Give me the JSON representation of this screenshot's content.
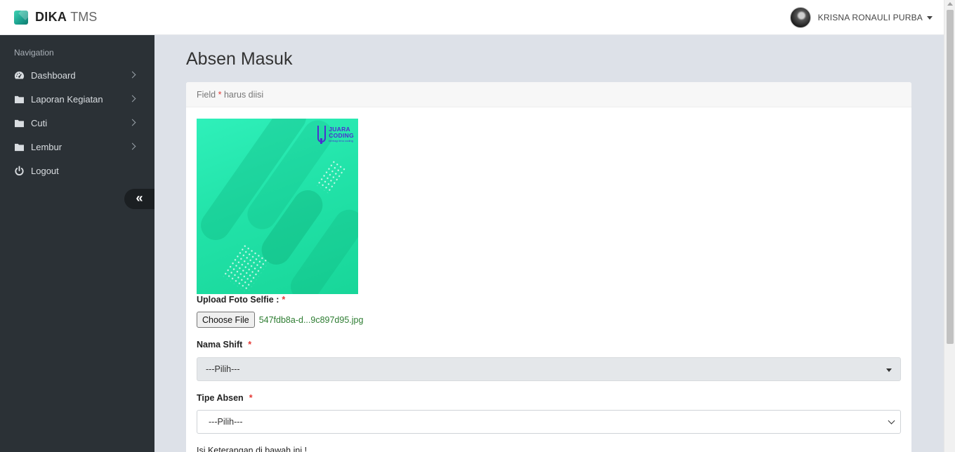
{
  "brand": {
    "name_bold": "DIKA",
    "name_light": "TMS"
  },
  "user": {
    "name": "KRISNA RONAULI PURBA"
  },
  "sidebar": {
    "heading": "Navigation",
    "items": [
      {
        "label": "Dashboard",
        "icon": "dashboard-icon"
      },
      {
        "label": "Laporan Kegiatan",
        "icon": "folder-icon"
      },
      {
        "label": "Cuti",
        "icon": "folder-icon"
      },
      {
        "label": "Lembur",
        "icon": "folder-icon"
      },
      {
        "label": "Logout",
        "icon": "power-icon"
      }
    ],
    "collapse_glyph": "«"
  },
  "page": {
    "title": "Absen Masuk"
  },
  "form": {
    "note_prefix": "Field",
    "note_star": "*",
    "note_suffix": "harus diisi",
    "preview_image": {
      "logo_line1": "JUARA",
      "logo_line2": "CODING",
      "logo_sub": "berbagi ilmu coding"
    },
    "upload_label": "Upload Foto Selfie :",
    "required_mark": "*",
    "file_button": "Choose File",
    "file_name": "547fdb8a-d...9c897d95.jpg",
    "shift_label": "Nama Shift",
    "shift_value": "---Pilih---",
    "tipe_label": "Tipe Absen",
    "tipe_value": "---Pilih---",
    "keterangan_label": "Isi Keterangan di bawah ini !"
  },
  "colors": {
    "sidebar_bg": "#2b3136",
    "content_bg": "#dde1e8",
    "required": "#e53935",
    "file_name": "#2e7d32",
    "preview_green": "#22e3a9"
  }
}
